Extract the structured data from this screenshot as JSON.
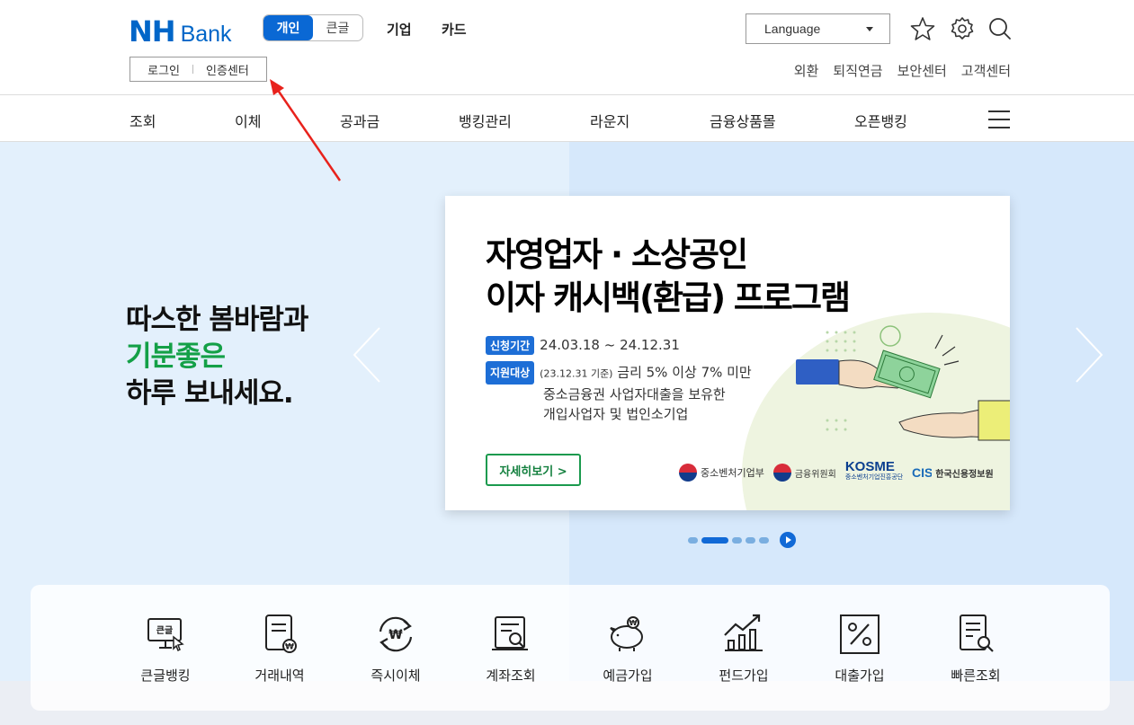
{
  "header": {
    "logo_nh": "NH",
    "logo_bank": "Bank",
    "mode_personal": "개인",
    "mode_large": "큰글",
    "top_links": [
      "기업",
      "카드"
    ],
    "language": "Language",
    "login": "로그인",
    "cert_center": "인증센터",
    "util_links": [
      "외환",
      "퇴직연금",
      "보안센터",
      "고객센터"
    ]
  },
  "gnb": {
    "items": [
      "조회",
      "이체",
      "공과금",
      "뱅킹관리",
      "라운지",
      "금융상품몰",
      "오픈뱅킹"
    ]
  },
  "hero": {
    "line1": "따스한 봄바람과",
    "line2": "기분좋은",
    "line3": "하루 보내세요."
  },
  "banner": {
    "title_line1": "자영업자 · 소상공인",
    "title_line2": "이자 캐시백(환급) 프로그램",
    "period_label": "신청기간",
    "period_value": "24.03.18 ~ 24.12.31",
    "target_label": "지원대상",
    "target_note": "(23.12.31 기준)",
    "target_line1": "금리 5% 이상 7% 미만",
    "target_line2": "중소금융권 사업자대출을 보유한",
    "target_line3": "개입사업자 및 법인소기업",
    "detail_button": "자세히보기  >",
    "sponsors": {
      "s1": "중소벤처기업부",
      "s2": "금융위원회",
      "s3_main": "KOSME",
      "s3_sub": "중소벤처기업진흥공단",
      "s4": "한국신용정보원"
    }
  },
  "quick_menu": [
    {
      "label": "큰글뱅킹"
    },
    {
      "label": "거래내역"
    },
    {
      "label": "즉시이체"
    },
    {
      "label": "계좌조회"
    },
    {
      "label": "예금가입"
    },
    {
      "label": "펀드가입"
    },
    {
      "label": "대출가입"
    },
    {
      "label": "빠른조회"
    }
  ],
  "colors": {
    "brand_blue": "#0066c8",
    "hero_green": "#14a047",
    "pill_blue": "#1d6ed6",
    "annotation_red": "#e8221c"
  }
}
